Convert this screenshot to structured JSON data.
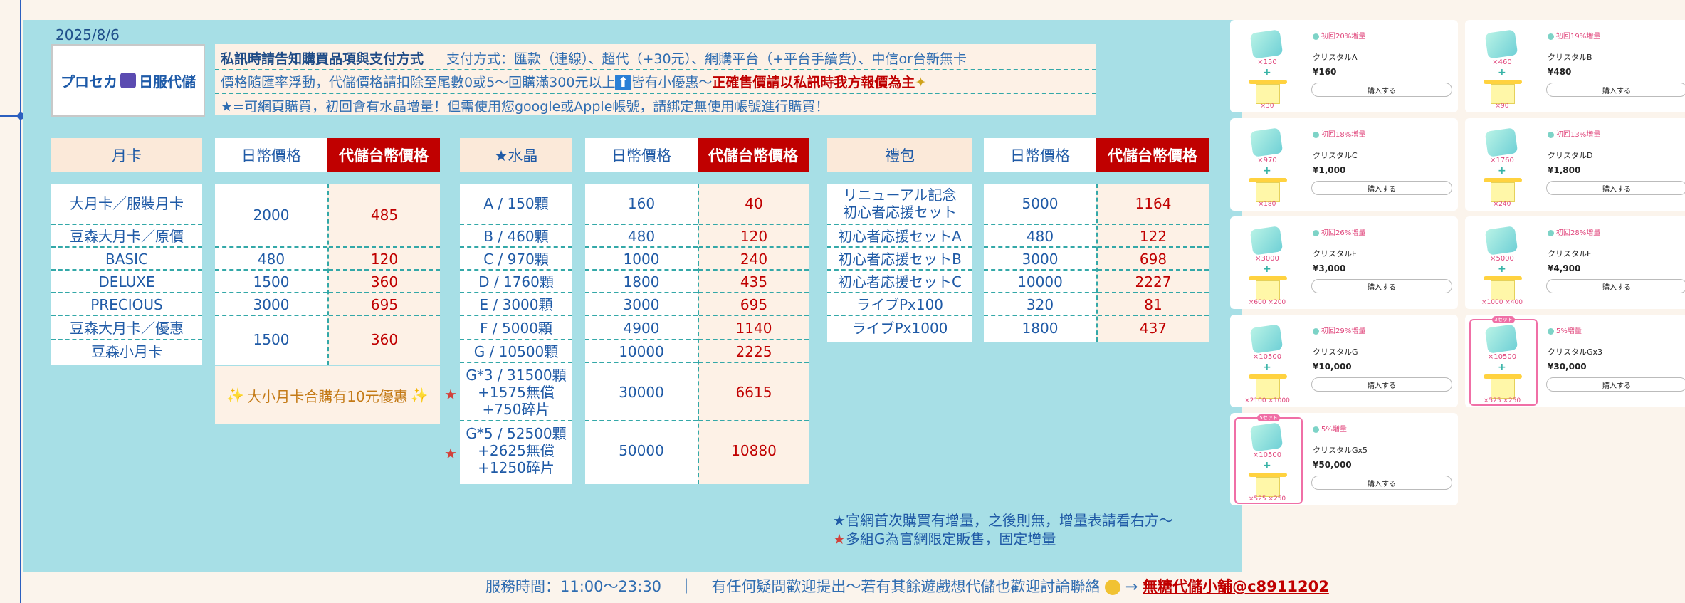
{
  "date": "2025/8/6",
  "logo": {
    "part1": "プロセカ",
    "part2": "日服代儲"
  },
  "info": {
    "line1_title": "私訊時請告知購買品項與支付方式",
    "line1_payment": "支付方式：匯款（連線）、超代（+30元）、網購平台（+平台手續費）、中信or台新無卡",
    "line2_text": "價格隨匯率浮動，代儲價格請扣除至尾數0或5～回購滿300元以上",
    "line2_icon": "⬆",
    "line2_text2": "皆有小優惠～",
    "line2_red": "正確售價請以私訊時我方報價為主",
    "line3": "★=可網頁購買，初回會有水晶增量！但需使用您google或Apple帳號，請綁定無使用帳號進行購買！"
  },
  "monthly": {
    "headers": {
      "item": "月卡",
      "jpy": "日幣價格",
      "twd": "代儲台幣價格"
    },
    "items": [
      "大月卡／服裝月卡",
      "豆森大月卡／原價",
      "BASIC",
      "DELUXE",
      "PRECIOUS",
      "豆森大月卡／優惠",
      "豆森小月卡"
    ],
    "jpy": [
      "2000",
      "480",
      "1500",
      "3000",
      "1500"
    ],
    "twd": [
      "485",
      "120",
      "360",
      "695",
      "360"
    ],
    "promo": "大小月卡合購有10元優惠",
    "sparkle": "✨"
  },
  "crystal": {
    "headers": {
      "item": "★水晶",
      "jpy": "日幣價格",
      "twd": "代儲台幣價格"
    },
    "items": [
      "A / 150顆",
      "B / 460顆",
      "C / 970顆",
      "D / 1760顆",
      "E / 3000顆",
      "F / 5000顆",
      "G / 10500顆"
    ],
    "item_g3": [
      "G*3 / 31500顆",
      "+1575無償",
      "+750碎片"
    ],
    "item_g5": [
      "G*5 / 52500顆",
      "+2625無償",
      "+1250碎片"
    ],
    "jpy": [
      "160",
      "480",
      "1000",
      "1800",
      "3000",
      "4900",
      "10000",
      "30000",
      "50000"
    ],
    "twd": [
      "40",
      "120",
      "240",
      "435",
      "695",
      "1140",
      "2225",
      "6615",
      "10880"
    ],
    "star": "★"
  },
  "gift": {
    "headers": {
      "item": "禮包",
      "jpy": "日幣價格",
      "twd": "代儲台幣價格"
    },
    "item1": [
      "リニューアル記念",
      "初心者応援セット"
    ],
    "items": [
      "初心者応援セットA",
      "初心者応援セットB",
      "初心者応援セットC",
      "ライブPx100",
      "ライブPx1000"
    ],
    "jpy": [
      "5000",
      "480",
      "3000",
      "10000",
      "320",
      "1800"
    ],
    "twd": [
      "1164",
      "122",
      "698",
      "2227",
      "81",
      "437"
    ]
  },
  "notes": {
    "star1": "★",
    "note1": "官網首次購買有增量，之後則無，增量表請看右方～",
    "star2": "★",
    "note2": "多組G為官網限定販售，固定增量"
  },
  "footer": {
    "hours": "服務時間：11:00～23:30",
    "sep": "｜",
    "text": "有任何疑問歡迎提出～若有其餘遊戲想代儲也歡迎討論聯絡",
    "arrow": "→",
    "link": "無糖代儲小舖@c8911202"
  },
  "shop": {
    "buy_label": "購入する",
    "cards": [
      {
        "amount": "×150",
        "bonus": "×30",
        "tag": "初回20%増量",
        "name": "クリスタルA",
        "price": "¥160"
      },
      {
        "amount": "×460",
        "bonus": "×90",
        "tag": "初回19%増量",
        "name": "クリスタルB",
        "price": "¥480"
      },
      {
        "amount": "×970",
        "bonus": "×180",
        "tag": "初回18%増量",
        "name": "クリスタルC",
        "price": "¥1,000"
      },
      {
        "amount": "×1760",
        "bonus": "×240",
        "tag": "初回13%増量",
        "name": "クリスタルD",
        "price": "¥1,800"
      },
      {
        "amount": "×3000",
        "bonus": "×600 ×200",
        "tag": "初回26%増量",
        "name": "クリスタルE",
        "price": "¥3,000"
      },
      {
        "amount": "×5000",
        "bonus": "×1000 ×400",
        "tag": "初回28%増量",
        "name": "クリスタルF",
        "price": "¥4,900"
      },
      {
        "amount": "×10500",
        "bonus": "×2100 ×1000",
        "tag": "初回29%増量",
        "name": "クリスタルG",
        "price": "¥10,000"
      },
      {
        "amount": "×10500",
        "bonus": "×525 ×250",
        "tag": "5%増量",
        "name": "クリスタルGx3",
        "price": "¥30,000",
        "set": "3セット"
      },
      {
        "amount": "×10500",
        "bonus": "×525 ×250",
        "tag": "5%増量",
        "name": "クリスタルGx5",
        "price": "¥50,000",
        "set": "5セット"
      }
    ]
  }
}
